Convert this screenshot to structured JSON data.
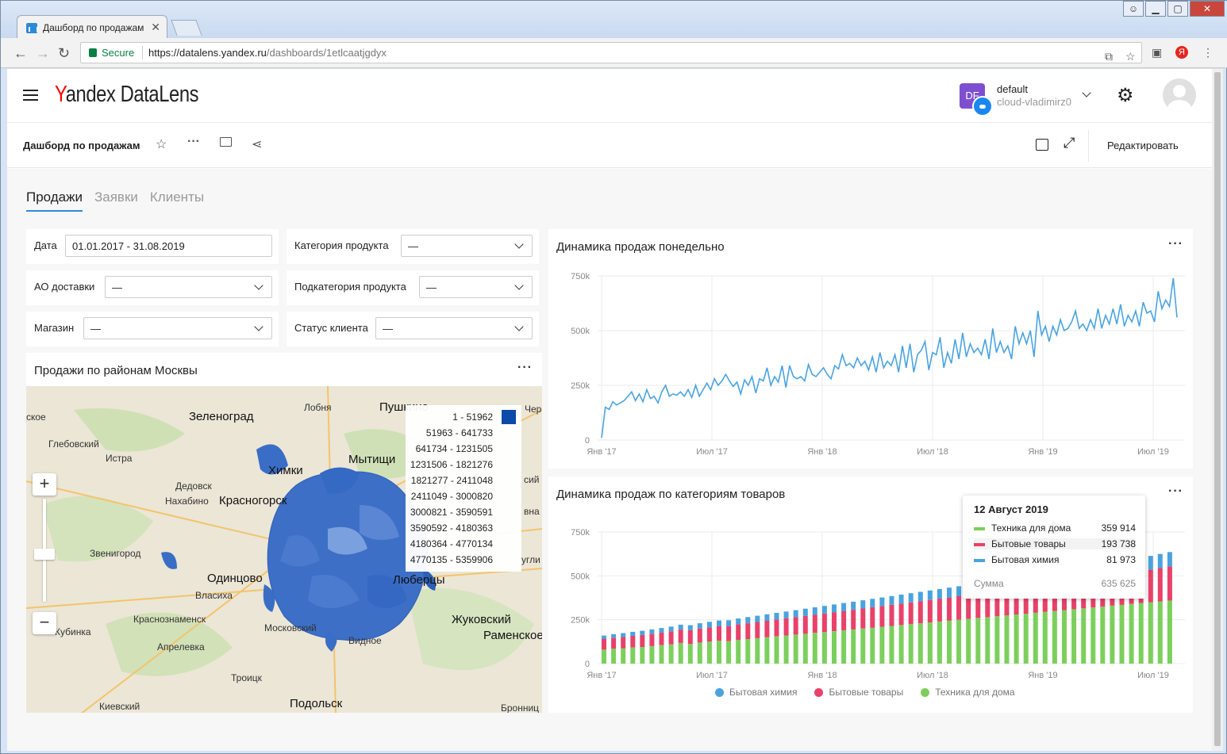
{
  "browser": {
    "tab_title": "Дашборд по продажам",
    "secure_label": "Secure",
    "url_main": "https://datalens.yandex.ru",
    "url_path": "/dashboards/1etlcaatjgdyx"
  },
  "header": {
    "logo_y": "Y",
    "logo_rest": "andex DataLens",
    "account_initials": "DF",
    "account_name": "default",
    "account_cloud": "cloud-vladimirz0"
  },
  "dashbar": {
    "title": "Дашборд по продажам",
    "edit_label": "Редактировать"
  },
  "tabs": [
    "Продажи",
    "Заявки",
    "Клиенты"
  ],
  "filters": {
    "date_label": "Дата",
    "date_value": "01.01.2017 - 31.08.2019",
    "category_label": "Категория продукта",
    "category_value": "—",
    "delivery_label": "АО доставки",
    "delivery_value": "—",
    "subcategory_label": "Подкатегория продукта",
    "subcategory_value": "—",
    "shop_label": "Магазин",
    "shop_value": "—",
    "status_label": "Статус клиента",
    "status_value": "—"
  },
  "map_widget": {
    "title": "Продажи по районам Москвы",
    "legend": [
      "1 - 51962",
      "51963 - 641733",
      "641734 - 1231505",
      "1231506 - 1821276",
      "1821277 - 2411048",
      "2411049 - 3000820",
      "3000821 - 3590591",
      "3590592 - 4180363",
      "4180364 - 4770134",
      "4770135 - 5359906"
    ],
    "legend_color": "#0b4aa8",
    "labels": [
      "Зеленоград",
      "Лобня",
      "Пушкино",
      "Чер",
      "ское",
      "Глебовский",
      "Истра",
      "Химки",
      "Мытищи",
      "Дедовск",
      "Нахабино",
      "Красногорск",
      "Звенигород",
      "Одинцово",
      "Власиха",
      "Люберцы",
      "Краснознаменск",
      "Жуковский",
      "Раменское",
      "Кубинка",
      "Московский",
      "Видное",
      "Апрелевка",
      "Троицк",
      "Подольск",
      "Киевский",
      "Бронниц",
      "сий",
      "вна",
      "угли"
    ]
  },
  "weekly_widget": {
    "title": "Динамика продаж понедельно",
    "color": "#4aa3df"
  },
  "category_widget": {
    "title": "Динамика продаж по категориям товаров",
    "tooltip": {
      "date": "12 Август 2019",
      "rows": [
        {
          "name": "Техника для дома",
          "value": "359 914",
          "color": "#7ccf5c"
        },
        {
          "name": "Бытовые товары",
          "value": "193 738",
          "color": "#e8416a"
        },
        {
          "name": "Бытовая химия",
          "value": "81 973",
          "color": "#4aa3df"
        }
      ],
      "sum_label": "Сумма",
      "sum_value": "635 625"
    },
    "legend": [
      {
        "name": "Бытовая химия",
        "color": "#4aa3df"
      },
      {
        "name": "Бытовые товары",
        "color": "#e8416a"
      },
      {
        "name": "Техника для дома",
        "color": "#7ccf5c"
      }
    ]
  },
  "chart_data": [
    {
      "type": "line",
      "x_ticks": [
        "Янв '17",
        "Июл '17",
        "Янв '18",
        "Июл '18",
        "Янв '19",
        "Июл '19"
      ],
      "y_ticks": [
        "750k",
        "500k",
        "250k",
        "0"
      ],
      "ylim": [
        0,
        750000
      ],
      "series": [
        {
          "values": [
            10000,
            150000,
            140000,
            175000,
            160000,
            170000,
            180000,
            200000,
            220000,
            180000,
            210000,
            175000,
            230000,
            190000,
            200000,
            170000,
            220000,
            250000,
            200000,
            210000,
            205000,
            220000,
            200000,
            230000,
            195000,
            250000,
            200000,
            230000,
            260000,
            230000,
            280000,
            250000,
            270000,
            300000,
            270000,
            245000,
            265000,
            210000,
            275000,
            250000,
            290000,
            215000,
            280000,
            270000,
            330000,
            250000,
            290000,
            265000,
            340000,
            240000,
            340000,
            290000,
            280000,
            290000,
            270000,
            345000,
            300000,
            290000,
            310000,
            330000,
            300000,
            280000,
            340000,
            325000,
            390000,
            340000,
            350000,
            330000,
            375000,
            340000,
            360000,
            320000,
            380000,
            310000,
            400000,
            330000,
            360000,
            340000,
            390000,
            310000,
            430000,
            330000,
            440000,
            310000,
            390000,
            410000,
            450000,
            320000,
            400000,
            390000,
            470000,
            330000,
            400000,
            350000,
            460000,
            370000,
            490000,
            380000,
            440000,
            400000,
            420000,
            390000,
            460000,
            370000,
            510000,
            400000,
            450000,
            400000,
            430000,
            370000,
            520000,
            440000,
            490000,
            440000,
            500000,
            380000,
            590000,
            480000,
            520000,
            450000,
            520000,
            480000,
            550000,
            500000,
            510000,
            540000,
            590000,
            510000,
            530000,
            500000,
            550000,
            510000,
            600000,
            510000,
            570000,
            530000,
            600000,
            530000,
            620000,
            520000,
            570000,
            540000,
            590000,
            520000,
            630000,
            580000,
            590000,
            540000,
            680000,
            600000,
            640000,
            610000,
            740000,
            560000
          ]
        }
      ]
    },
    {
      "type": "bar",
      "stacked": true,
      "x_ticks": [
        "Янв '17",
        "Июл '17",
        "Янв '18",
        "Июл '18",
        "Янв '19",
        "Июл '19"
      ],
      "y_ticks": [
        "750k",
        "500k",
        "250k",
        "0"
      ],
      "ylim": [
        0,
        750000
      ],
      "series": [
        {
          "name": "Техника для дома",
          "values": [
            80000,
            85000,
            88000,
            92000,
            95000,
            100000,
            105000,
            110000,
            118000,
            112000,
            120000,
            125000,
            130000,
            128000,
            135000,
            140000,
            145000,
            150000,
            155000,
            160000,
            165000,
            170000,
            175000,
            180000,
            185000,
            190000,
            195000,
            200000,
            205000,
            210000,
            215000,
            220000,
            225000,
            230000,
            235000,
            240000,
            245000,
            250000,
            255000,
            260000,
            265000,
            270000,
            275000,
            280000,
            285000,
            290000,
            295000,
            300000,
            305000,
            310000,
            315000,
            320000,
            325000,
            330000,
            335000,
            340000,
            345000,
            350000,
            355000,
            359914
          ]
        },
        {
          "name": "Бытовые товары",
          "values": [
            60000,
            62000,
            64000,
            66000,
            68000,
            70000,
            72000,
            74000,
            76000,
            78000,
            80000,
            82000,
            84000,
            86000,
            88000,
            90000,
            92000,
            94000,
            96000,
            98000,
            100000,
            102000,
            104000,
            106000,
            108000,
            110000,
            112000,
            114000,
            116000,
            118000,
            120000,
            122000,
            124000,
            126000,
            128000,
            130000,
            132000,
            134000,
            136000,
            138000,
            140000,
            142000,
            144000,
            146000,
            148000,
            150000,
            152000,
            154000,
            156000,
            158000,
            160000,
            162000,
            164000,
            166000,
            168000,
            170000,
            180000,
            185000,
            190000,
            193738
          ]
        },
        {
          "name": "Бытовая химия",
          "values": [
            20000,
            21000,
            22000,
            23000,
            24000,
            25000,
            26000,
            27000,
            28000,
            29000,
            30000,
            31000,
            32000,
            33000,
            34000,
            35000,
            36000,
            37000,
            38000,
            39000,
            40000,
            41000,
            42000,
            43000,
            44000,
            45000,
            46000,
            47000,
            48000,
            49000,
            50000,
            51000,
            52000,
            53000,
            54000,
            55000,
            56000,
            57000,
            58000,
            59000,
            60000,
            61000,
            62000,
            63000,
            64000,
            65000,
            66000,
            67000,
            68000,
            69000,
            70000,
            71000,
            72000,
            73000,
            74000,
            75000,
            77000,
            79000,
            80000,
            81973
          ]
        }
      ]
    }
  ]
}
